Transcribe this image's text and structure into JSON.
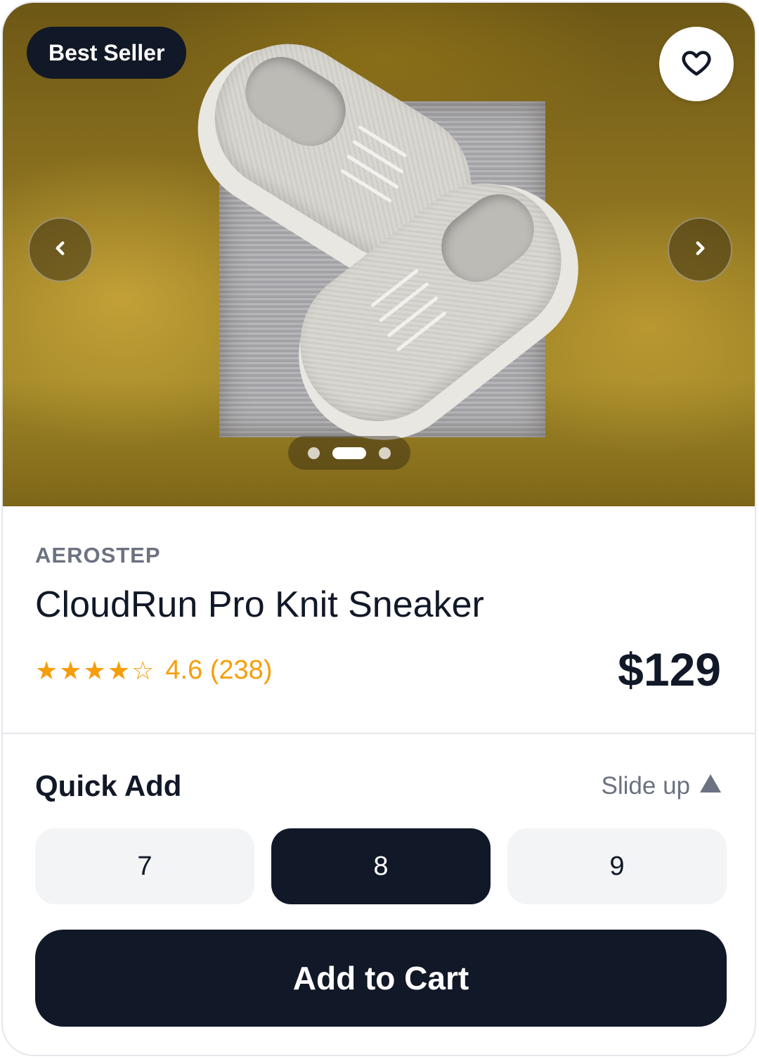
{
  "product": {
    "badge": "Best Seller",
    "brand": "AEROSTEP",
    "name": "CloudRun Pro Knit Sneaker",
    "rating": {
      "stars_filled": 4,
      "stars_total": 5,
      "stars_text": "★★★★☆",
      "summary": "4.6 (238)"
    },
    "price": "$129"
  },
  "gallery": {
    "image_count": 3,
    "active_index": 1,
    "prev_icon": "chevron-left-icon",
    "next_icon": "chevron-right-icon",
    "favorite_icon": "heart-icon"
  },
  "quick_add": {
    "title": "Quick Add",
    "slide_label": "Slide up",
    "slide_icon": "triangle-up-icon",
    "sizes": [
      "7",
      "8",
      "9"
    ],
    "selected_size": "8"
  },
  "cta": {
    "add_to_cart": "Add to Cart"
  },
  "colors": {
    "primary": "#111827",
    "muted": "#6b7280",
    "star": "#f59e0b",
    "chip_bg": "#f3f4f6"
  }
}
